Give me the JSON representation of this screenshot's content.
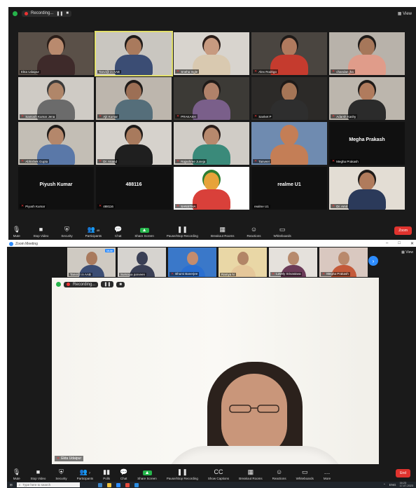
{
  "panel1": {
    "recording_label": "Recording...",
    "view_label": "View",
    "tiles": [
      {
        "name": "Ekta Udaipur",
        "muted": false,
        "kind": "video",
        "bg": "#5a5048",
        "skin": "#b98a6e",
        "shirt": "#3e2a2a",
        "hair": "#2a1d18"
      },
      {
        "name": "Tanvi@ in AAB",
        "muted": false,
        "kind": "video",
        "bg": "#c9c6c0",
        "skin": "#a97a5d",
        "shirt": "#3b4d74",
        "hair": "#1e1a18",
        "active": true
      },
      {
        "name": "Sneha Ingle",
        "muted": true,
        "kind": "video",
        "bg": "#d8d4ce",
        "skin": "#c79a80",
        "shirt": "#d9c9b0",
        "hair": "#2a1d18"
      },
      {
        "name": "Alex Rodrigo",
        "muted": true,
        "kind": "video",
        "bg": "#4a4540",
        "skin": "#b07a5e",
        "shirt": "#c53b2e",
        "hair": "#1e1a18"
      },
      {
        "name": "chandan jha",
        "muted": true,
        "kind": "video",
        "bg": "#b8b2aa",
        "skin": "#a6775a",
        "shirt": "#e09c8a",
        "hair": "#1e1a18"
      },
      {
        "name": "Santosh Kumar Jena",
        "muted": true,
        "kind": "video",
        "bg": "#cfcbc5",
        "skin": "#b08669",
        "shirt": "#6b6b6b",
        "hair": "#3a3a3a"
      },
      {
        "name": "Ajit Kumar",
        "muted": true,
        "kind": "video",
        "bg": "#bdb6ad",
        "skin": "#9c6f55",
        "shirt": "#556e7a",
        "hair": "#1e1a18"
      },
      {
        "name": "PRAKASH",
        "muted": true,
        "kind": "video",
        "bg": "#3c3a36",
        "skin": "#b0826a",
        "shirt": "#7a5f8a",
        "hair": "#1e1a18"
      },
      {
        "name": "Sanket P",
        "muted": true,
        "kind": "video",
        "bg": "#2c2a28",
        "skin": "#a57556",
        "shirt": "#2e2e2e",
        "hair": "#1e1a18"
      },
      {
        "name": "Adarsh Kashy",
        "muted": true,
        "kind": "video",
        "bg": "#bcb6ad",
        "skin": "#b07b5d",
        "shirt": "#2b2b2b",
        "hair": "#1e1a18"
      },
      {
        "name": "Abhishek Gupta",
        "muted": true,
        "kind": "video",
        "bg": "#c3beb5",
        "skin": "#b4876b",
        "shirt": "#5a78a8",
        "hair": "#1e1a18"
      },
      {
        "name": "Dr. Anand",
        "muted": true,
        "kind": "video",
        "bg": "#d6d2cc",
        "skin": "#a87a5d",
        "shirt": "#1f1f1f",
        "hair": "#1e1a18"
      },
      {
        "name": "Rajashree Juneja",
        "muted": true,
        "kind": "video",
        "bg": "#d0ccc6",
        "skin": "#b7896d",
        "shirt": "#3a8a7a",
        "hair": "#2a1d18"
      },
      {
        "name": "Tanveer",
        "muted": true,
        "kind": "video",
        "bg": "#6f8bb0",
        "skin": "#c47e56",
        "shirt": "#c47e56",
        "hair": "#c47e56"
      },
      {
        "name": "Megha Prakash",
        "muted": true,
        "kind": "name",
        "label": "Megha Prakash"
      },
      {
        "name": "Piyush Kumar",
        "muted": true,
        "kind": "name",
        "label": "Piyush Kumar"
      },
      {
        "name": "488116",
        "muted": true,
        "kind": "name",
        "label": "488116"
      },
      {
        "name": "SANSTHA",
        "muted": true,
        "kind": "video",
        "bg": "#ffffff",
        "skin": "#e7a33a",
        "shirt": "#d9403a",
        "hair": "#2e7d32"
      },
      {
        "name": "realme U1",
        "muted": false,
        "kind": "name",
        "label": "realme U1"
      },
      {
        "name": "Dr. Amit",
        "muted": true,
        "kind": "video",
        "bg": "#e3ddd4",
        "skin": "#b07b5c",
        "shirt": "#2b3a5a",
        "hair": "#1e1a18"
      }
    ],
    "toolbar": {
      "items": [
        "Mute",
        "Stop Video",
        "Security",
        "Participants",
        "Chat",
        "Share Screen",
        "Pause/Stop Recording",
        "Breakout Rooms",
        "Reactions",
        "Whiteboards"
      ],
      "participants_count": "49",
      "end": "Zoom"
    }
  },
  "panel2": {
    "app_title": "Zoom Meeting",
    "view_label": "View",
    "strip": [
      {
        "name": "Tanvi@ in AAB",
        "muted": false,
        "skin": "#a97a5d",
        "shirt": "#3b4d74",
        "bg": "#cfcac2",
        "mute_tag": "Mute"
      },
      {
        "name": "Sumaiya parveen",
        "muted": false,
        "skin": "#3a3f55",
        "shirt": "#3a3f55",
        "bg": "#d6d3cf",
        "mute_tag": ""
      },
      {
        "name": "Bhumi Banerjee",
        "muted": true,
        "skin": "#c48c6e",
        "shirt": "#2a6fd1",
        "bg": "#3a78c9",
        "mute_tag": ""
      },
      {
        "name": "Ramya N",
        "muted": false,
        "skin": "#b28567",
        "shirt": "#e5c79a",
        "bg": "#e9d7a6",
        "mute_tag": ""
      },
      {
        "name": "Lovely Srivastava",
        "muted": true,
        "skin": "#b78a6d",
        "shirt": "#6b3b58",
        "bg": "#e5e1dc",
        "mute_tag": ""
      },
      {
        "name": "Megha Prakash",
        "muted": true,
        "skin": "#b9896c",
        "shirt": "#c45a3a",
        "bg": "#d9c8c0",
        "mute_tag": ""
      }
    ],
    "recording_label": "Recording...",
    "speaker_name": "Ekta Udaipur",
    "toolbar": {
      "items": [
        "Mute",
        "Stop Video",
        "Security",
        "Participants",
        "Polls",
        "Chat",
        "Share Screen",
        "Pause/Stop Recording",
        "Show Captions",
        "Breakout Rooms",
        "Reactions",
        "Whiteboards",
        "More"
      ],
      "participants_count": "7",
      "end": "End"
    },
    "taskbar": {
      "search_placeholder": "Type here to search",
      "time": "16:23",
      "date": "17-07-2023",
      "lang": "ENG"
    }
  }
}
